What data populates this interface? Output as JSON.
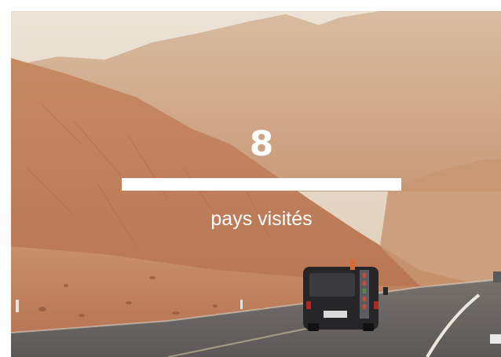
{
  "stat": {
    "value": "8",
    "label": "pays visités"
  },
  "colors": {
    "sky": "#e7dccd",
    "mountain": "#c9936f",
    "road": "#5f5e5c",
    "overlay_text": "#ffffff"
  }
}
